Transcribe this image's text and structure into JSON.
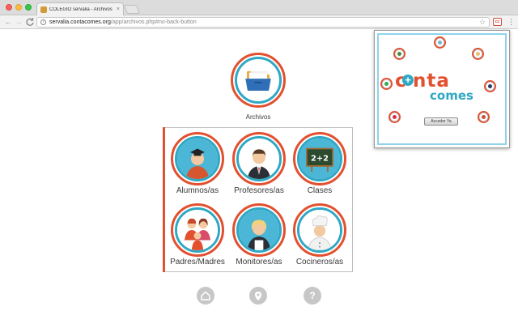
{
  "browser": {
    "tab_title": "COLEGIO servalia - Archivos",
    "tab_close": "×",
    "url_host": "servalia.contacomes.org",
    "url_path": "/app/archivos.php#no-back-button",
    "nav_back": "←",
    "nav_forward": "→",
    "nav_reload": "C",
    "star": "☆",
    "ext_label": "cc",
    "menu": "⋮"
  },
  "main": {
    "archivos_label": "Archivos",
    "cells": [
      {
        "label": "Alumnos/as"
      },
      {
        "label": "Profesores/as"
      },
      {
        "label": "Clases"
      },
      {
        "label": "Padres/Madres"
      },
      {
        "label": "Monitores/as"
      },
      {
        "label": "Cocineros/as"
      }
    ],
    "clases_board_text": "2+2"
  },
  "footer": {
    "help_glyph": "?"
  },
  "popup": {
    "logo_c": "c",
    "logo_plus": "+",
    "logo_conta": "nta",
    "logo_comes": "comes",
    "button_label": "Acceder Ya"
  },
  "colors": {
    "accent_red": "#e2502f",
    "accent_blue": "#2fa8c4",
    "footer_grey": "#c7c7c7"
  }
}
